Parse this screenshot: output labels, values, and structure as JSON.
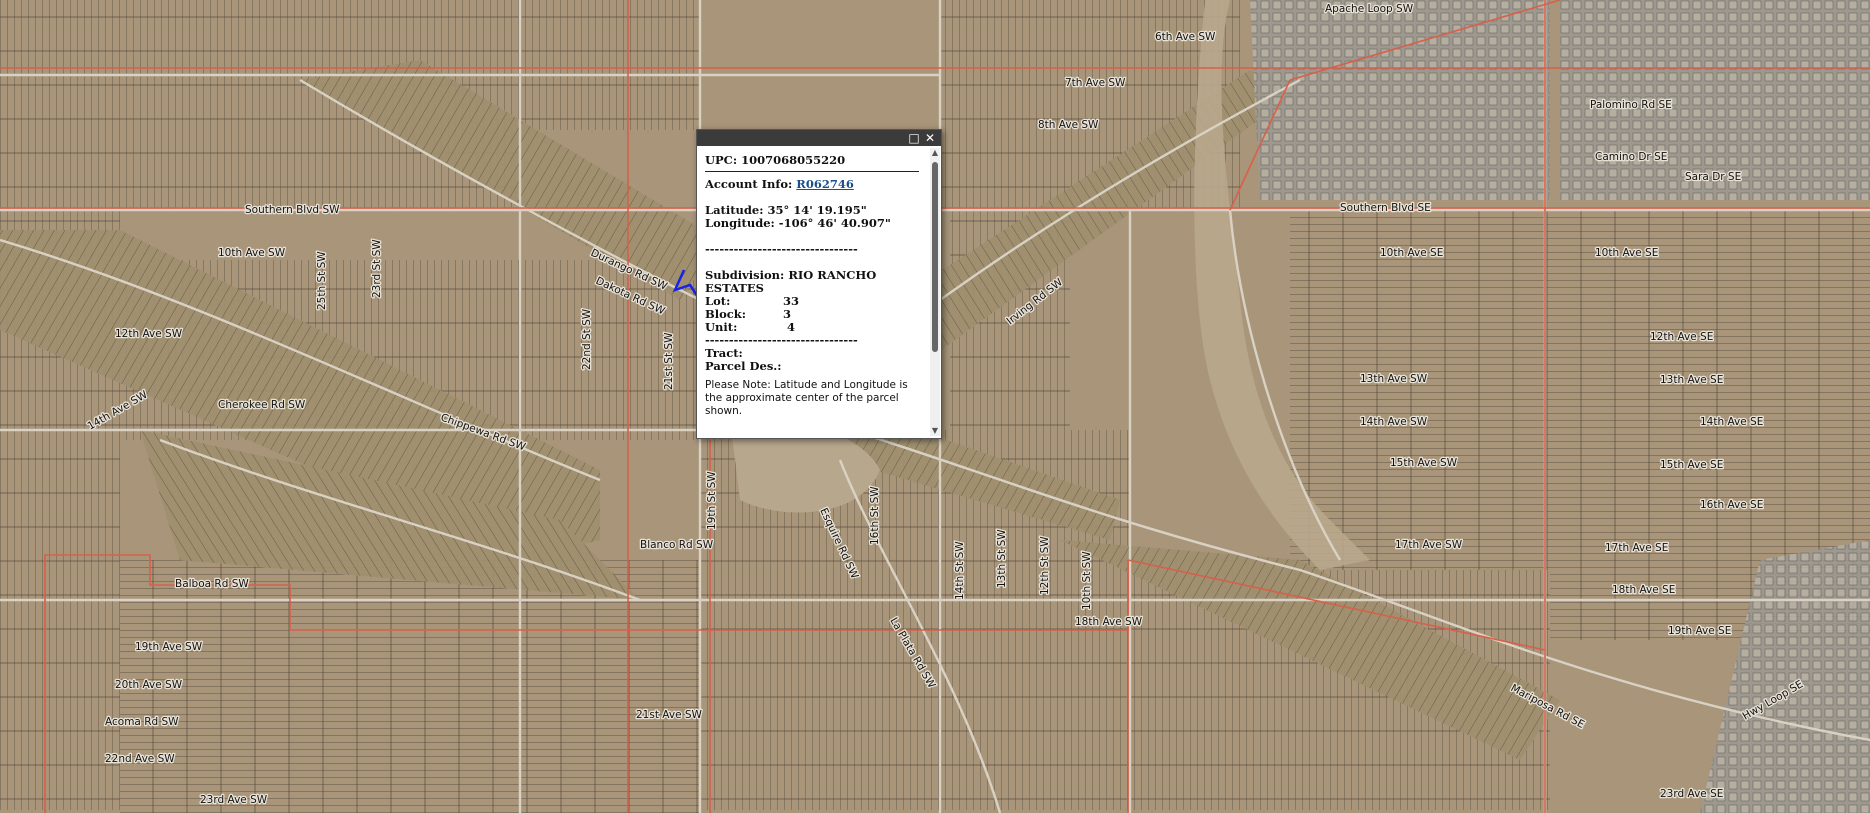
{
  "popup": {
    "upc": "UPC: 1007068055220",
    "account_label": "Account Info:",
    "account_link": "R062746",
    "latitude": "Latitude: 35° 14' 19.195\"",
    "longitude": "Longitude: -106° 46' 40.907\"",
    "separator": "--------------------------------",
    "subdivision_label": "Subdivision:",
    "subdivision_value": "RIO RANCHO ESTATES",
    "lot_label": "Lot:",
    "lot_value": "33",
    "block_label": "Block:",
    "block_value": "3",
    "unit_label": "Unit:",
    "unit_value": "4",
    "tract_label": "Tract:",
    "parcel_label": "Parcel Des.:",
    "note": "Please Note: Latitude and Longitude is the approximate center of the parcel shown.",
    "maximize_icon": "maximize-icon",
    "close_icon": "close-icon"
  },
  "colors": {
    "terrain": "#a8957a",
    "parcel_line": "#4a4034",
    "road": "#d9d2c4",
    "boundary": "#d8604a",
    "selected_parcel": "#1a22e6"
  },
  "street_labels": [
    "6th Ave SW",
    "Apache Loop SW",
    "Southern Blvd SW",
    "10th Ave SW",
    "12th Ave SW",
    "14th Ave SW",
    "Cherokee Rd SW",
    "Chippewa Rd SW",
    "Balboa Rd SW",
    "19th Ave SW",
    "20th Ave SW",
    "Acoma Rd SW",
    "22nd Ave SW",
    "23rd Ave SW",
    "21st Ave SW",
    "Blanco Rd SW",
    "Durango Rd SW",
    "Dakota Rd SW",
    "Irving Rd SW",
    "Southern Blvd SE",
    "10th Ave SE",
    "12th Ave SE",
    "13th Ave SE",
    "14th Ave SE",
    "15th Ave SE",
    "16th Ave SE",
    "17th Ave SE",
    "18th Ave SE",
    "19th Ave SE",
    "23rd Ave SE",
    "7th Ave SW",
    "8th Ave SW",
    "10th Ave SE",
    "13th Ave SW",
    "14th Ave SW",
    "15th Ave SW",
    "17th Ave SW",
    "18th Ave SW",
    "Sara Dr SE",
    "Camino Dr SE",
    "Palomino Rd SE",
    "25th St SW",
    "23rd St SW",
    "22nd St SW",
    "21st St SW",
    "19th St SW",
    "16th St SW",
    "14th St SW",
    "13th St SW",
    "12th St SW",
    "10th St SW",
    "Hwy Loop SE",
    "Mariposa Rd SE",
    "Esquire Rd SW",
    "La Plata Rd SW"
  ]
}
